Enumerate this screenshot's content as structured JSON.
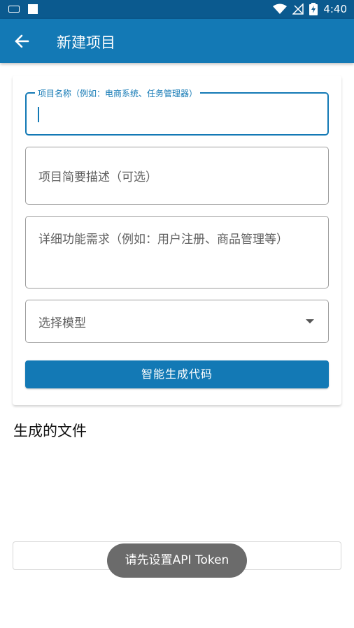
{
  "status_bar": {
    "time": "4:40",
    "icons": [
      "keyboard-icon",
      "notification-square-icon",
      "wifi-icon",
      "no-signal-icon",
      "battery-charging-icon"
    ]
  },
  "app_bar": {
    "title": "新建项目",
    "back_icon": "arrow-left-icon"
  },
  "form": {
    "project_name": {
      "label": "项目名称（例如：电商系统、任务管理器）",
      "value": ""
    },
    "description": {
      "placeholder": "项目简要描述（可选）"
    },
    "requirements": {
      "placeholder": "详细功能需求（例如：用户注册、商品管理等）"
    },
    "model_select": {
      "placeholder": "选择模型"
    },
    "generate_button": "智能生成代码"
  },
  "generated_files": {
    "title": "生成的文件"
  },
  "toast": "请先设置API Token",
  "colors": {
    "primary": "#1379b5",
    "status_bar": "#0b5a8f",
    "toast_bg": "#6b6b6b"
  }
}
